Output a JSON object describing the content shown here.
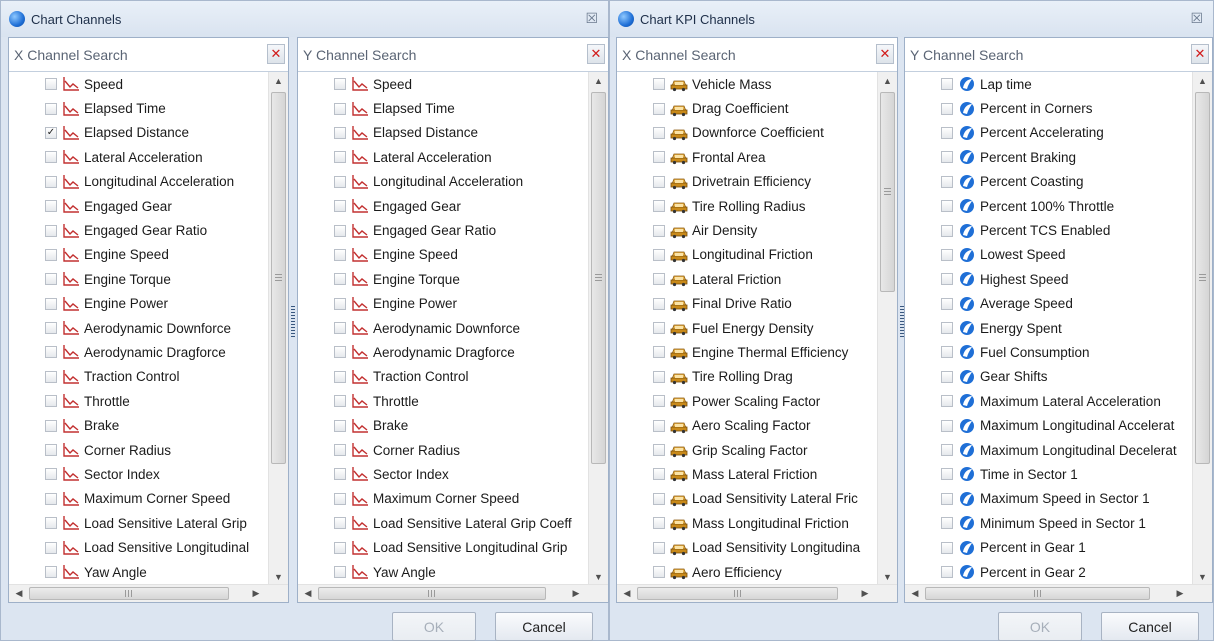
{
  "windows": [
    {
      "title": "Chart Channels",
      "close_glyph": "☒",
      "ok_label": "OK",
      "cancel_label": "Cancel",
      "panels": [
        {
          "placeholder": "X Channel Search",
          "clear_glyph": "✕",
          "icon": "line-chart-icon",
          "items": [
            {
              "label": "Speed",
              "checked": false
            },
            {
              "label": "Elapsed Time",
              "checked": false
            },
            {
              "label": "Elapsed Distance",
              "checked": true
            },
            {
              "label": "Lateral Acceleration",
              "checked": false
            },
            {
              "label": "Longitudinal Acceleration",
              "checked": false
            },
            {
              "label": "Engaged Gear",
              "checked": false
            },
            {
              "label": "Engaged Gear Ratio",
              "checked": false
            },
            {
              "label": "Engine Speed",
              "checked": false
            },
            {
              "label": "Engine Torque",
              "checked": false
            },
            {
              "label": "Engine Power",
              "checked": false
            },
            {
              "label": "Aerodynamic Downforce",
              "checked": false
            },
            {
              "label": "Aerodynamic Dragforce",
              "checked": false
            },
            {
              "label": "Traction Control",
              "checked": false
            },
            {
              "label": "Throttle",
              "checked": false
            },
            {
              "label": "Brake",
              "checked": false
            },
            {
              "label": "Corner Radius",
              "checked": false
            },
            {
              "label": "Sector Index",
              "checked": false
            },
            {
              "label": "Maximum Corner Speed",
              "checked": false
            },
            {
              "label": "Load Sensitive Lateral Grip",
              "checked": false
            },
            {
              "label": "Load Sensitive Longitudinal",
              "checked": false
            },
            {
              "label": "Yaw Angle",
              "checked": false
            }
          ]
        },
        {
          "placeholder": "Y Channel Search",
          "clear_glyph": "✕",
          "icon": "line-chart-icon",
          "items": [
            {
              "label": "Speed",
              "checked": false
            },
            {
              "label": "Elapsed Time",
              "checked": false
            },
            {
              "label": "Elapsed Distance",
              "checked": false
            },
            {
              "label": "Lateral Acceleration",
              "checked": false
            },
            {
              "label": "Longitudinal Acceleration",
              "checked": false
            },
            {
              "label": "Engaged Gear",
              "checked": false
            },
            {
              "label": "Engaged Gear Ratio",
              "checked": false
            },
            {
              "label": "Engine Speed",
              "checked": false
            },
            {
              "label": "Engine Torque",
              "checked": false
            },
            {
              "label": "Engine Power",
              "checked": false
            },
            {
              "label": "Aerodynamic Downforce",
              "checked": false
            },
            {
              "label": "Aerodynamic Dragforce",
              "checked": false
            },
            {
              "label": "Traction Control",
              "checked": false
            },
            {
              "label": "Throttle",
              "checked": false
            },
            {
              "label": "Brake",
              "checked": false
            },
            {
              "label": "Corner Radius",
              "checked": false
            },
            {
              "label": "Sector Index",
              "checked": false
            },
            {
              "label": "Maximum Corner Speed",
              "checked": false
            },
            {
              "label": "Load Sensitive Lateral Grip Coeff",
              "checked": false
            },
            {
              "label": "Load Sensitive Longitudinal Grip",
              "checked": false
            },
            {
              "label": "Yaw Angle",
              "checked": false
            }
          ]
        }
      ]
    },
    {
      "title": "Chart KPI Channels",
      "close_glyph": "☒",
      "ok_label": "OK",
      "cancel_label": "Cancel",
      "panels": [
        {
          "placeholder": "X Channel Search",
          "clear_glyph": "✕",
          "icon": "car-icon",
          "items": [
            {
              "label": "Vehicle Mass",
              "checked": false
            },
            {
              "label": "Drag Coefficient",
              "checked": false
            },
            {
              "label": "Downforce Coefficient",
              "checked": false
            },
            {
              "label": "Frontal Area",
              "checked": false
            },
            {
              "label": "Drivetrain Efficiency",
              "checked": false
            },
            {
              "label": "Tire Rolling Radius",
              "checked": false
            },
            {
              "label": "Air Density",
              "checked": false
            },
            {
              "label": "Longitudinal Friction",
              "checked": false
            },
            {
              "label": "Lateral Friction",
              "checked": false
            },
            {
              "label": "Final Drive Ratio",
              "checked": false
            },
            {
              "label": "Fuel Energy Density",
              "checked": false
            },
            {
              "label": "Engine Thermal Efficiency",
              "checked": false
            },
            {
              "label": "Tire Rolling Drag",
              "checked": false
            },
            {
              "label": "Power Scaling Factor",
              "checked": false
            },
            {
              "label": "Aero Scaling Factor",
              "checked": false
            },
            {
              "label": "Grip Scaling Factor",
              "checked": false
            },
            {
              "label": "Mass Lateral Friction",
              "checked": false
            },
            {
              "label": "Load Sensitivity Lateral Fric",
              "checked": false
            },
            {
              "label": "Mass Longitudinal Friction",
              "checked": false
            },
            {
              "label": "Load Sensitivity Longitudina",
              "checked": false
            },
            {
              "label": "Aero Efficiency",
              "checked": false
            }
          ]
        },
        {
          "placeholder": "Y Channel Search",
          "clear_glyph": "✕",
          "icon": "app-logo-icon",
          "items": [
            {
              "label": "Lap time",
              "checked": false
            },
            {
              "label": "Percent in Corners",
              "checked": false
            },
            {
              "label": "Percent Accelerating",
              "checked": false
            },
            {
              "label": "Percent Braking",
              "checked": false
            },
            {
              "label": "Percent Coasting",
              "checked": false
            },
            {
              "label": "Percent 100% Throttle",
              "checked": false
            },
            {
              "label": "Percent TCS Enabled",
              "checked": false
            },
            {
              "label": "Lowest Speed",
              "checked": false
            },
            {
              "label": "Highest Speed",
              "checked": false
            },
            {
              "label": "Average Speed",
              "checked": false
            },
            {
              "label": "Energy Spent",
              "checked": false
            },
            {
              "label": "Fuel Consumption",
              "checked": false
            },
            {
              "label": "Gear Shifts",
              "checked": false
            },
            {
              "label": "Maximum Lateral Acceleration",
              "checked": false
            },
            {
              "label": "Maximum Longitudinal Accelerat",
              "checked": false
            },
            {
              "label": "Maximum Longitudinal Decelerat",
              "checked": false
            },
            {
              "label": "Time in Sector 1",
              "checked": false
            },
            {
              "label": "Maximum Speed in Sector 1",
              "checked": false
            },
            {
              "label": "Minimum Speed in Sector 1",
              "checked": false
            },
            {
              "label": "Percent in Gear 1",
              "checked": false
            },
            {
              "label": "Percent in Gear 2",
              "checked": false
            }
          ]
        }
      ]
    }
  ],
  "scroll_glyphs": {
    "up": "▲",
    "down": "▼",
    "left": "◀",
    "right": "▶"
  },
  "check_glyph": "✓",
  "colors": {
    "accent_blue": "#1f6fd6",
    "line_icon_red": "#c23030",
    "car_icon_orange": "#c98a1a",
    "clear_red": "#d11a1a",
    "window_bg": "#dce5f1"
  }
}
